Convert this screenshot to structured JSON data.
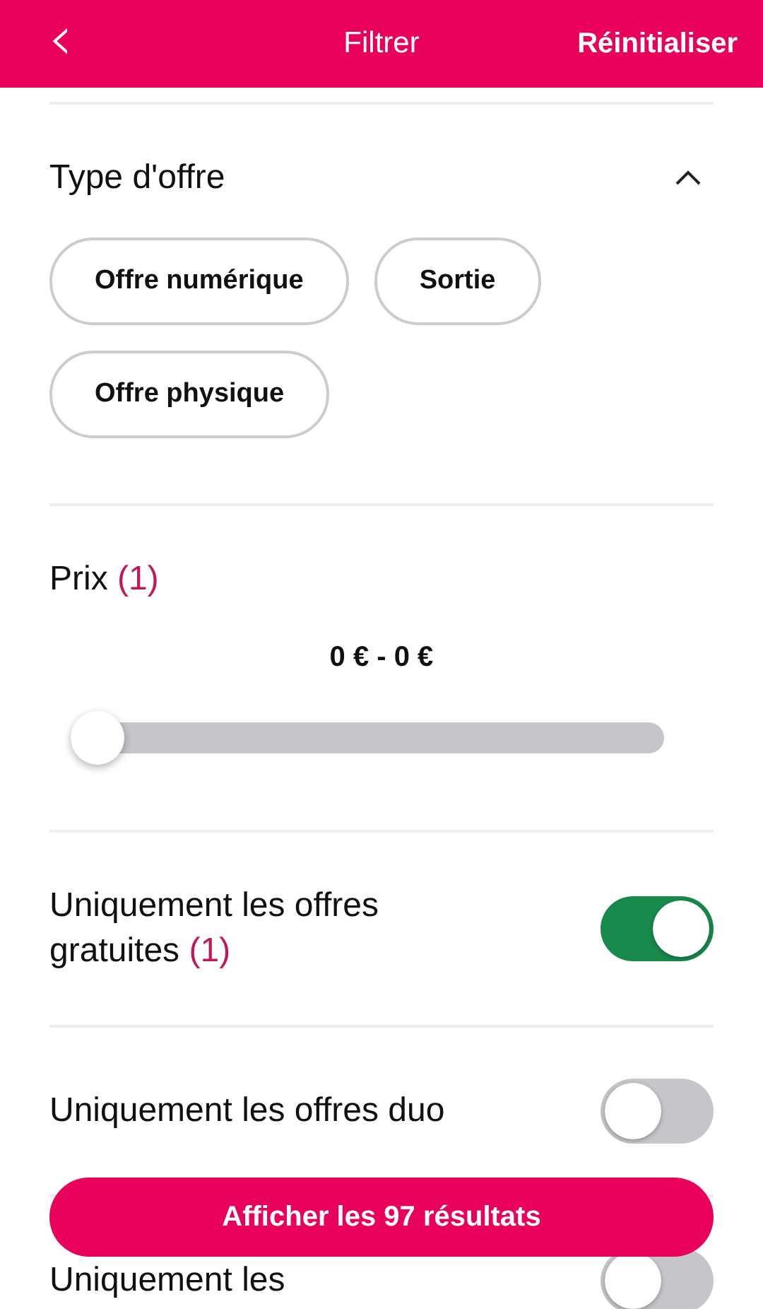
{
  "header": {
    "back": "‹",
    "title": "Filtrer",
    "reset": "Réinitialiser"
  },
  "offer_type": {
    "title": "Type d'offre",
    "expanded": true,
    "chips": [
      "Offre numérique",
      "Sortie",
      "Offre physique"
    ]
  },
  "price": {
    "label": "Prix",
    "count": "(1)",
    "range": "0 € - 0 €",
    "level": 0
  },
  "toggles": [
    {
      "label": "Uniquement les offres gratuites",
      "count": "(1)",
      "on": true
    },
    {
      "label": "Uniquement les offres duo",
      "on": false
    },
    {
      "label": "Uniquement les",
      "on": false
    }
  ],
  "action_button": "Afficher les 97 résultats"
}
